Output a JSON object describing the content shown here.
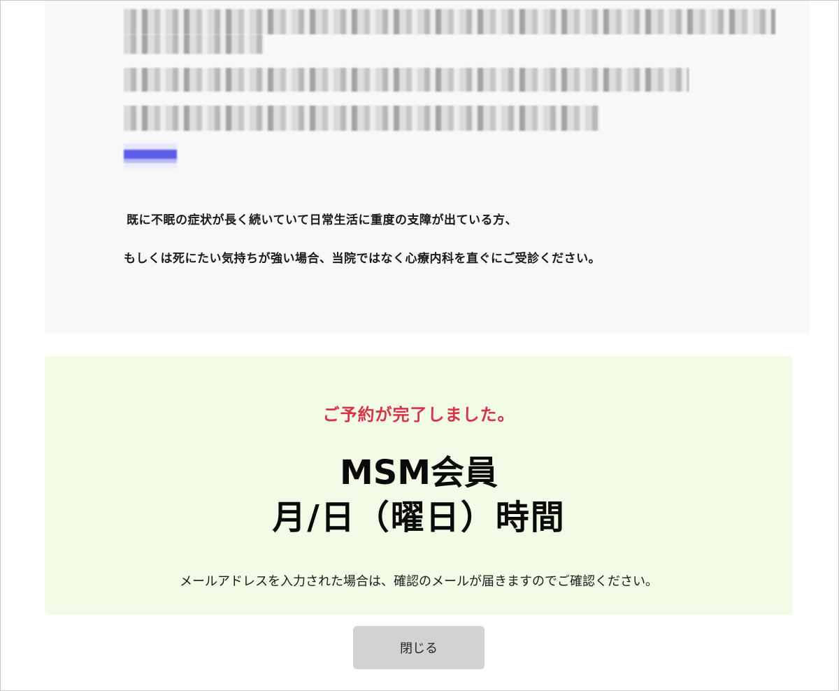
{
  "notice": {
    "line1": "既に不眠の症状が長く続いていて日常生活に重度の支障が出ている方、",
    "line2": "もしくは死にたい気持ちが強い場合、当院ではなく心療内科を直ぐにご受診ください。"
  },
  "confirmation": {
    "complete_message": "ご予約が完了しました。",
    "membership": "MSM会員",
    "datetime": "月/日（曜日）時間",
    "email_note": "メールアドレスを入力された場合は、確認のメールが届きますのでご確認ください。"
  },
  "actions": {
    "close_label": "閉じる"
  },
  "colors": {
    "complete_message": "#d8324a",
    "confirm_panel_bg": "#f2fbe5",
    "notice_panel_bg": "#f8f8f9",
    "close_button_bg": "#d2d2d2"
  }
}
